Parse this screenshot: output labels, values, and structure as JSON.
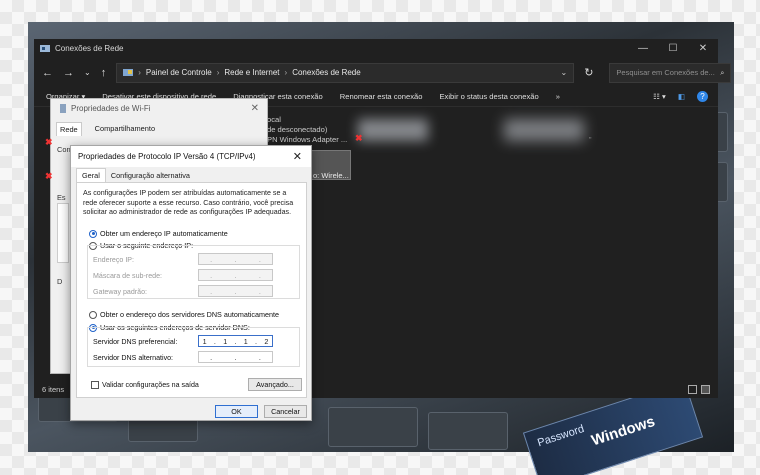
{
  "explorer": {
    "title": "Conexões de Rede",
    "breadcrumb": [
      "Painel de Controle",
      "Rede e Internet",
      "Conexões de Rede"
    ],
    "search_placeholder": "Pesquisar em Conexões de...",
    "commands": [
      "Organizar ▾",
      "Desativar este dispositivo de rede",
      "Diagnosticar esta conexão",
      "Renomear esta conexão",
      "Exibir o status desta conexão",
      "»"
    ],
    "conn_lines": [
      "ocal",
      "de desconectado)",
      "PN Windows Adapter ...",
      "o: Wirele..."
    ],
    "status": "6 itens"
  },
  "wifi_dialog": {
    "title": "Propriedades de Wi-Fi",
    "tabs": [
      "Rede",
      "Compartilhamento"
    ],
    "side_labels": [
      "Conectar-se",
      "Es",
      "D"
    ]
  },
  "ipv4_dialog": {
    "title": "Propriedades de Protocolo IP Versão 4 (TCP/IPv4)",
    "tabs": [
      "Geral",
      "Configuração alternativa"
    ],
    "description": "As configurações IP podem ser atribuídas automaticamente se a rede oferecer suporte a esse recurso. Caso contrário, você precisa solicitar ao administrador de rede as configurações IP adequadas.",
    "ip_auto_label": "Obter um endereço IP automaticamente",
    "ip_manual_label": "Usar o seguinte endereço IP:",
    "ip_fields": {
      "address_label": "Endereço IP:",
      "mask_label": "Máscara de sub-rede:",
      "gateway_label": "Gateway padrão:"
    },
    "dns_auto_label": "Obter o endereço dos servidores DNS automaticamente",
    "dns_manual_label": "Usar os seguintes endereços de servidor DNS:",
    "dns_preferred_label": "Servidor DNS preferencial:",
    "dns_preferred_octets": [
      "1",
      "1",
      "1",
      "2"
    ],
    "dns_alternate_label": "Servidor DNS alternativo:",
    "validate_label": "Validar configurações na saída",
    "advanced_label": "Avançado...",
    "ok_label": "OK",
    "cancel_label": "Cancelar"
  },
  "background": {
    "password_text": "Password",
    "windows_text": "Windows"
  }
}
